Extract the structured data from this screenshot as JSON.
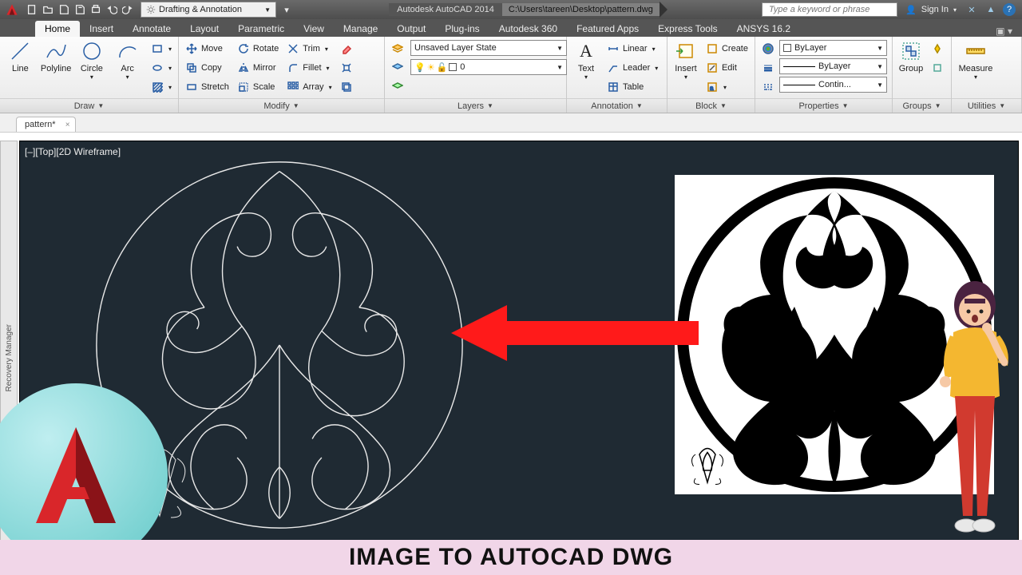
{
  "title": {
    "app": "Autodesk AutoCAD 2014",
    "path": "C:\\Users\\tareen\\Desktop\\pattern.dwg"
  },
  "workspace": "Drafting & Annotation",
  "search_placeholder": "Type a keyword or phrase",
  "signin": "Sign In",
  "ribbon_tabs": [
    "Home",
    "Insert",
    "Annotate",
    "Layout",
    "Parametric",
    "View",
    "Manage",
    "Output",
    "Plug-ins",
    "Autodesk 360",
    "Featured Apps",
    "Express Tools",
    "ANSYS 16.2"
  ],
  "panels": {
    "draw": {
      "title": "Draw",
      "line": "Line",
      "polyline": "Polyline",
      "circle": "Circle",
      "arc": "Arc"
    },
    "modify": {
      "title": "Modify",
      "move": "Move",
      "copy": "Copy",
      "stretch": "Stretch",
      "rotate": "Rotate",
      "mirror": "Mirror",
      "scale": "Scale",
      "trim": "Trim",
      "fillet": "Fillet",
      "array": "Array"
    },
    "layers": {
      "title": "Layers",
      "state": "Unsaved Layer State",
      "current": "0"
    },
    "annotation": {
      "title": "Annotation",
      "text": "Text",
      "linear": "Linear",
      "leader": "Leader",
      "table": "Table"
    },
    "block": {
      "title": "Block",
      "insert": "Insert",
      "create": "Create",
      "edit": "Edit"
    },
    "properties": {
      "title": "Properties",
      "color": "ByLayer",
      "ltype": "ByLayer",
      "lwt": "Contin..."
    },
    "groups": {
      "title": "Groups",
      "group": "Group"
    },
    "utilities": {
      "title": "Utilities",
      "measure": "Measure"
    }
  },
  "doc_tab": "pattern*",
  "viewport": "[–][Top][2D Wireframe]",
  "recovery": "Recovery Manager",
  "banner": "IMAGE TO AUTOCAD DWG"
}
